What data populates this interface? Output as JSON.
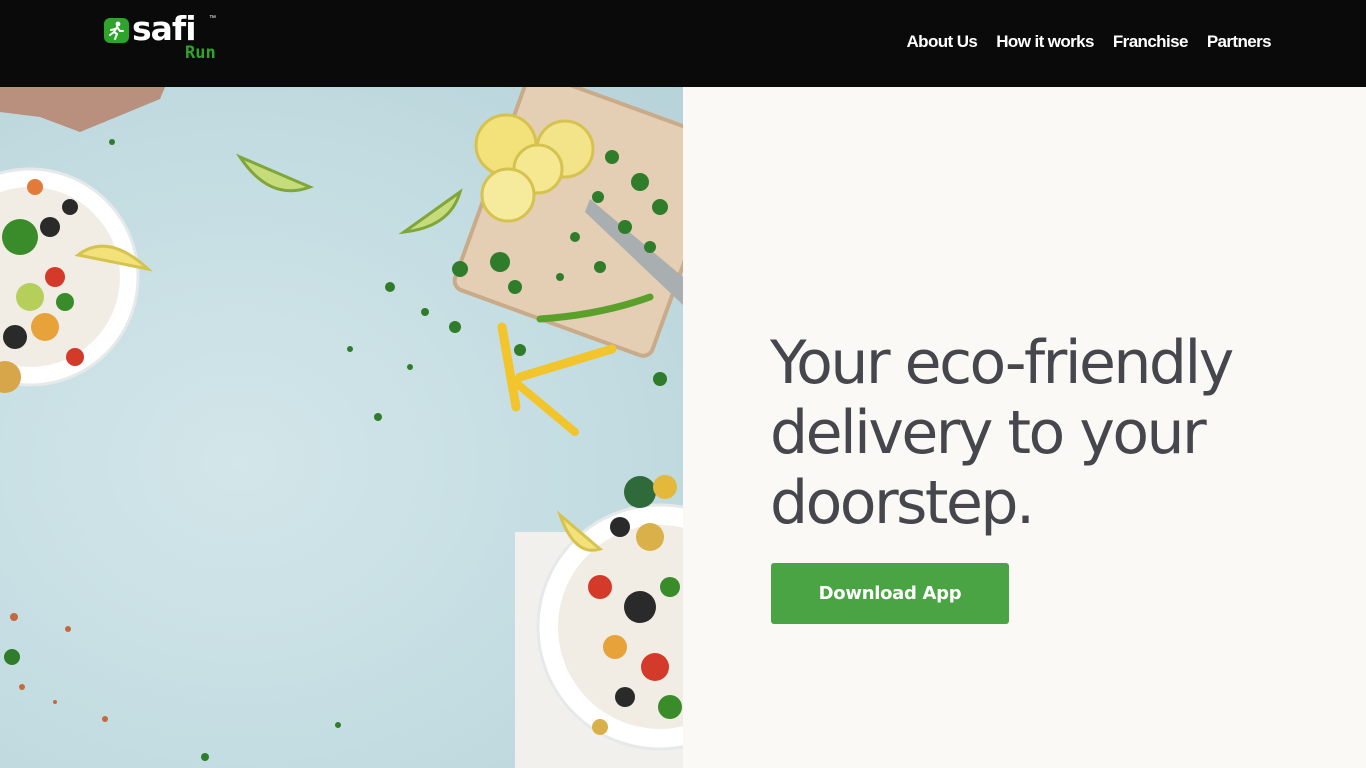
{
  "brand": {
    "wordmark": "safi",
    "trademark": "™",
    "subtitle": "Run",
    "accent_color": "#2ea52a",
    "icon": "runner-icon"
  },
  "nav": {
    "items": [
      {
        "label": "About Us"
      },
      {
        "label": "How it works"
      },
      {
        "label": "Franchise"
      },
      {
        "label": "Partners"
      }
    ]
  },
  "hero": {
    "headline": "Your eco-friendly delivery to your doorstep.",
    "cta_label": "Download App",
    "cta_color": "#4aa443",
    "photo": "food-bowls-photo"
  }
}
